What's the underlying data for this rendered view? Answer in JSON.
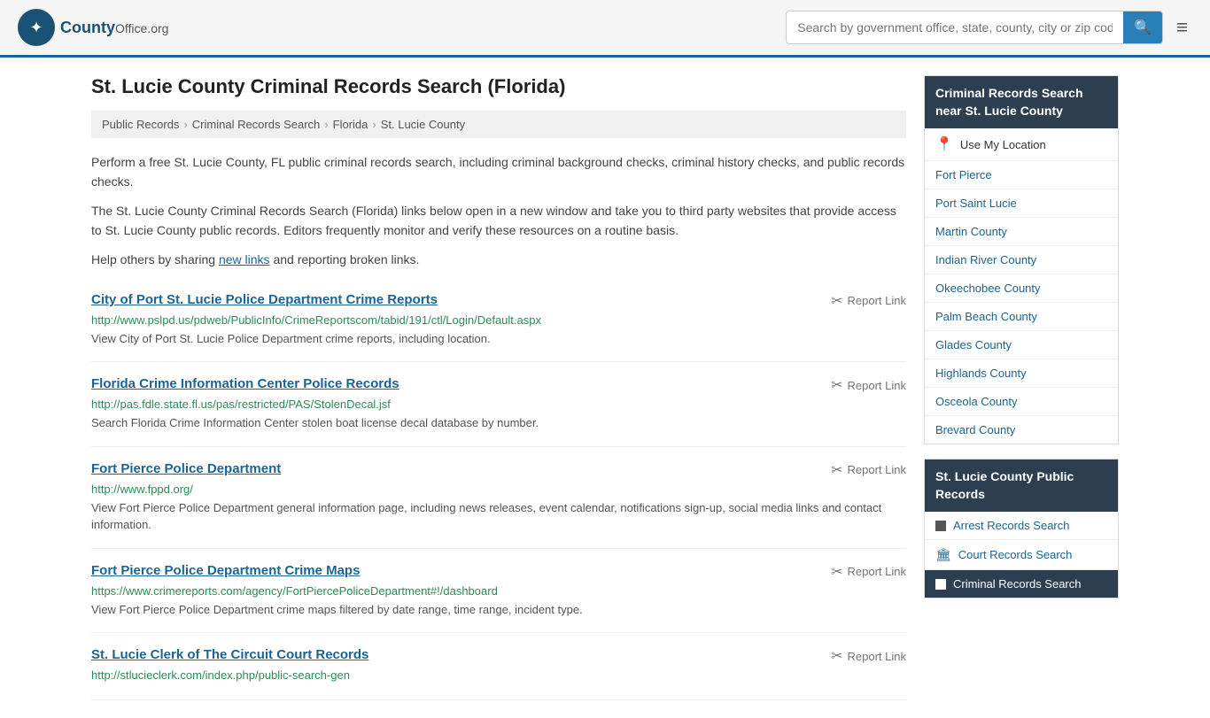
{
  "header": {
    "logo_text": "County",
    "logo_suffix": "Office.org",
    "logo_symbol": "✦",
    "search_placeholder": "Search by government office, state, county, city or zip code",
    "search_button_icon": "🔍",
    "menu_icon": "≡"
  },
  "page": {
    "title": "St. Lucie County Criminal Records Search (Florida)",
    "breadcrumb": [
      {
        "label": "Public Records",
        "sep": ">"
      },
      {
        "label": "Criminal Records Search",
        "sep": ">"
      },
      {
        "label": "Florida",
        "sep": ">"
      },
      {
        "label": "St. Lucie County",
        "sep": ""
      }
    ],
    "description1": "Perform a free St. Lucie County, FL public criminal records search, including criminal background checks, criminal history checks, and public records checks.",
    "description2": "The St. Lucie County Criminal Records Search (Florida) links below open in a new window and take you to third party websites that provide access to St. Lucie County public records. Editors frequently monitor and verify these resources on a routine basis.",
    "description3_pre": "Help others by sharing ",
    "description3_link": "new links",
    "description3_post": " and reporting broken links."
  },
  "results": [
    {
      "title": "City of Port St. Lucie Police Department Crime Reports",
      "url": "http://www.pslpd.us/pdweb/PublicInfo/CrimeReportscom/tabid/191/ctl/Login/Default.aspx",
      "desc": "View City of Port St. Lucie Police Department crime reports, including location.",
      "report_label": "Report Link"
    },
    {
      "title": "Florida Crime Information Center Police Records",
      "url": "http://pas.fdle.state.fl.us/pas/restricted/PAS/StolenDecal.jsf",
      "desc": "Search Florida Crime Information Center stolen boat license decal database by number.",
      "report_label": "Report Link"
    },
    {
      "title": "Fort Pierce Police Department",
      "url": "http://www.fppd.org/",
      "desc": "View Fort Pierce Police Department general information page, including news releases, event calendar, notifications sign-up, social media links and contact information.",
      "report_label": "Report Link"
    },
    {
      "title": "Fort Pierce Police Department Crime Maps",
      "url": "https://www.crimereports.com/agency/FortPiercePoliceDepartment#!/dashboard",
      "desc": "View Fort Pierce Police Department crime maps filtered by date range, time range, incident type.",
      "report_label": "Report Link"
    },
    {
      "title": "St. Lucie Clerk of The Circuit Court Records",
      "url": "http://stlucieclerk.com/index.php/public-search-gen",
      "desc": "",
      "report_label": "Report Link"
    }
  ],
  "sidebar": {
    "nearby_header": "Criminal Records Search near St. Lucie County",
    "nearby_items": [
      {
        "label": "Use My Location",
        "type": "location"
      },
      {
        "label": "Fort Pierce",
        "type": "link"
      },
      {
        "label": "Port Saint Lucie",
        "type": "link"
      },
      {
        "label": "Martin County",
        "type": "link"
      },
      {
        "label": "Indian River County",
        "type": "link"
      },
      {
        "label": "Okeechobee County",
        "type": "link"
      },
      {
        "label": "Palm Beach County",
        "type": "link"
      },
      {
        "label": "Glades County",
        "type": "link"
      },
      {
        "label": "Highlands County",
        "type": "link"
      },
      {
        "label": "Osceola County",
        "type": "link"
      },
      {
        "label": "Brevard County",
        "type": "link"
      }
    ],
    "public_records_header": "St. Lucie County Public Records",
    "public_records_items": [
      {
        "label": "Arrest Records Search",
        "type": "square",
        "active": false
      },
      {
        "label": "Court Records Search",
        "type": "building",
        "active": false
      },
      {
        "label": "Criminal Records Search",
        "type": "square",
        "active": true
      }
    ]
  }
}
